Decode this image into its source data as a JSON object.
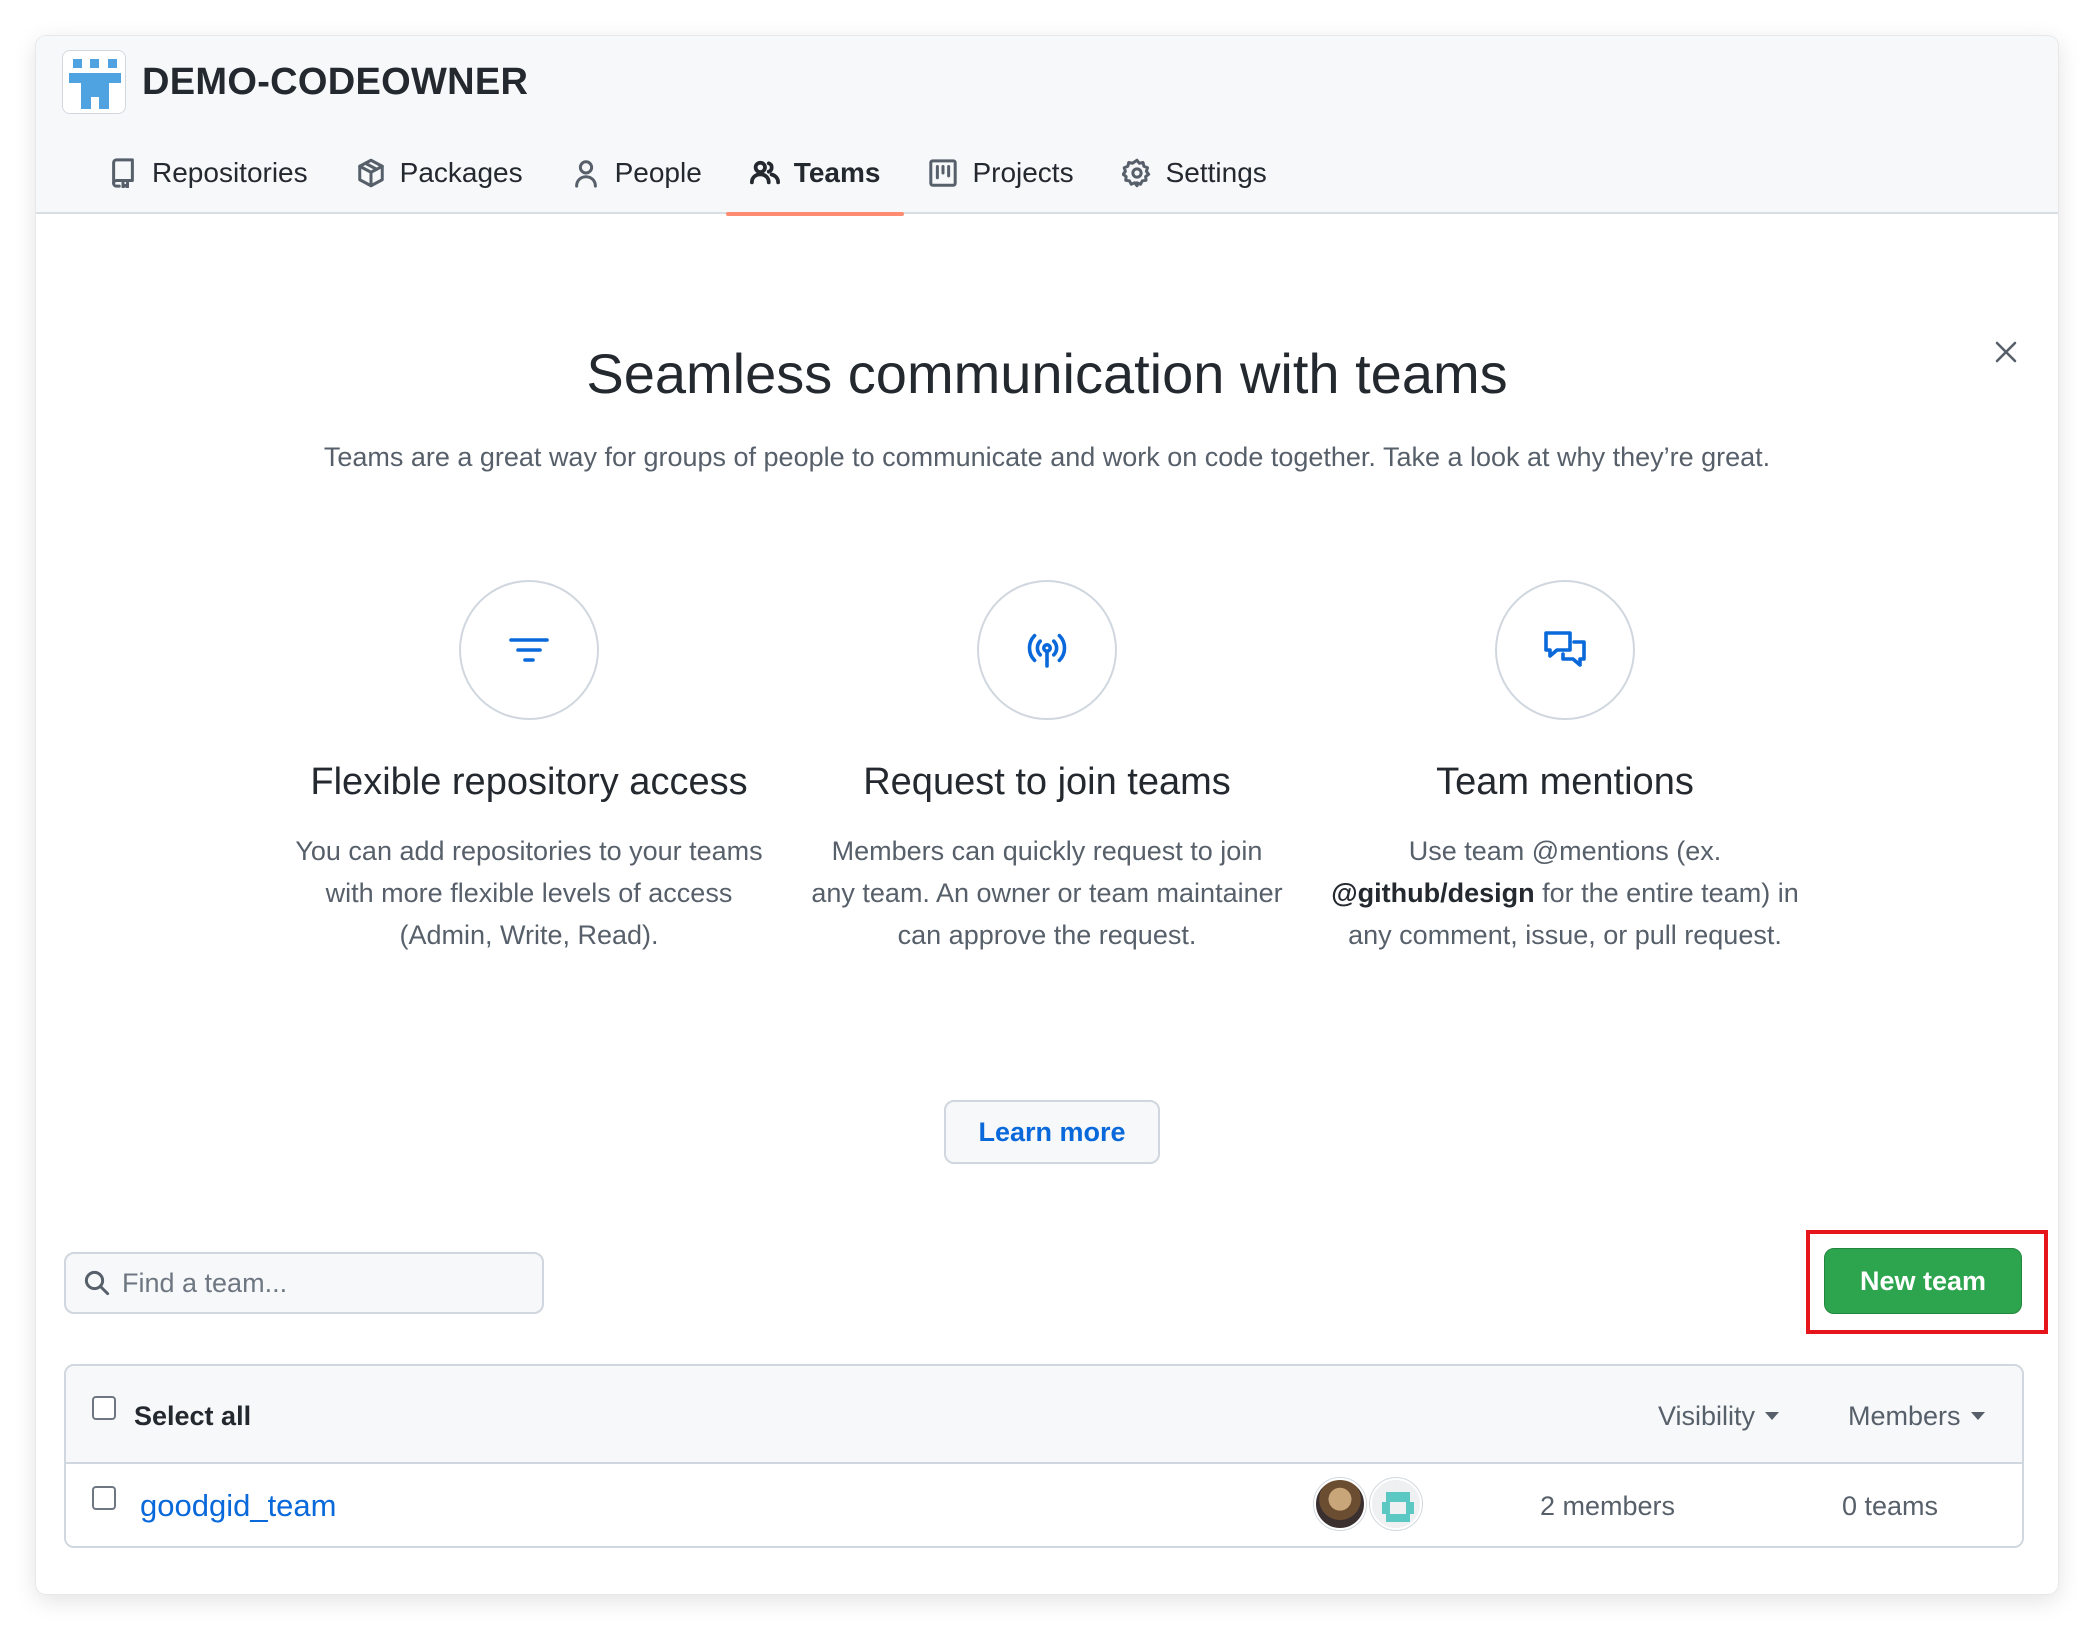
{
  "org": {
    "name": "DEMO-CODEOWNER",
    "logo": "identicon-logo"
  },
  "nav": {
    "items": [
      {
        "label": "Repositories",
        "icon": "repo-icon"
      },
      {
        "label": "Packages",
        "icon": "package-icon"
      },
      {
        "label": "People",
        "icon": "person-icon"
      },
      {
        "label": "Teams",
        "icon": "people-icon",
        "active": true
      },
      {
        "label": "Projects",
        "icon": "project-icon"
      },
      {
        "label": "Settings",
        "icon": "gear-icon"
      }
    ]
  },
  "promo": {
    "title": "Seamless communication with teams",
    "subtitle": "Teams are a great way for groups of people to communicate and work on code together. Take a look at why they’re great.",
    "features": [
      {
        "icon": "filter-icon",
        "title": "Flexible repository access",
        "description": "You can add repositories to your teams with more flexible levels of access (Admin, Write, Read)."
      },
      {
        "icon": "broadcast-icon",
        "title": "Request to join teams",
        "description": "Members can quickly request to join any team. An owner or team maintainer can approve the request."
      },
      {
        "icon": "comment-discussion-icon",
        "title": "Team mentions",
        "description_pre": "Use team @mentions (ex. ",
        "description_bold": "@github/design",
        "description_post": " for the entire team) in any comment, issue, or pull request."
      }
    ],
    "learn_more_label": "Learn more",
    "close_icon": "close-icon"
  },
  "search": {
    "placeholder": "Find a team...",
    "value": ""
  },
  "new_team_label": "New team",
  "table": {
    "select_all_label": "Select all",
    "visibility_label": "Visibility",
    "members_label": "Members",
    "rows": [
      {
        "name": "goodgid_team",
        "members": "2 members",
        "teams": "0 teams"
      }
    ]
  },
  "colors": {
    "accent": "#0969da",
    "primary_button": "#2da44e",
    "active_underline": "#fd8c73",
    "highlight_box": "#e5151b"
  }
}
